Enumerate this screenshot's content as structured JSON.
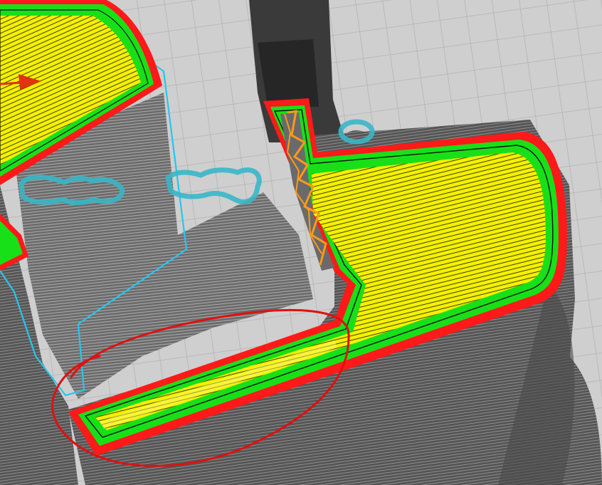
{
  "app": {
    "view": "slicer-layer-preview",
    "description_title": ""
  },
  "colors": {
    "build_plate": "#cfcfcf",
    "grid_line": "#b5b5b5",
    "printed_layers": "#5a5a5a",
    "layer_line": "#8a8a8a",
    "outer_wall": "#ff1a1a",
    "inner_wall": "#18e018",
    "infill": "#f4f000",
    "support": "#ff9a1a",
    "selected_outline": "#26c6f0",
    "travel_highlight": "#38b6c8",
    "direction_arrow": "#e0330f",
    "annotation_circle": "#e01010"
  },
  "legend": {
    "items": []
  }
}
